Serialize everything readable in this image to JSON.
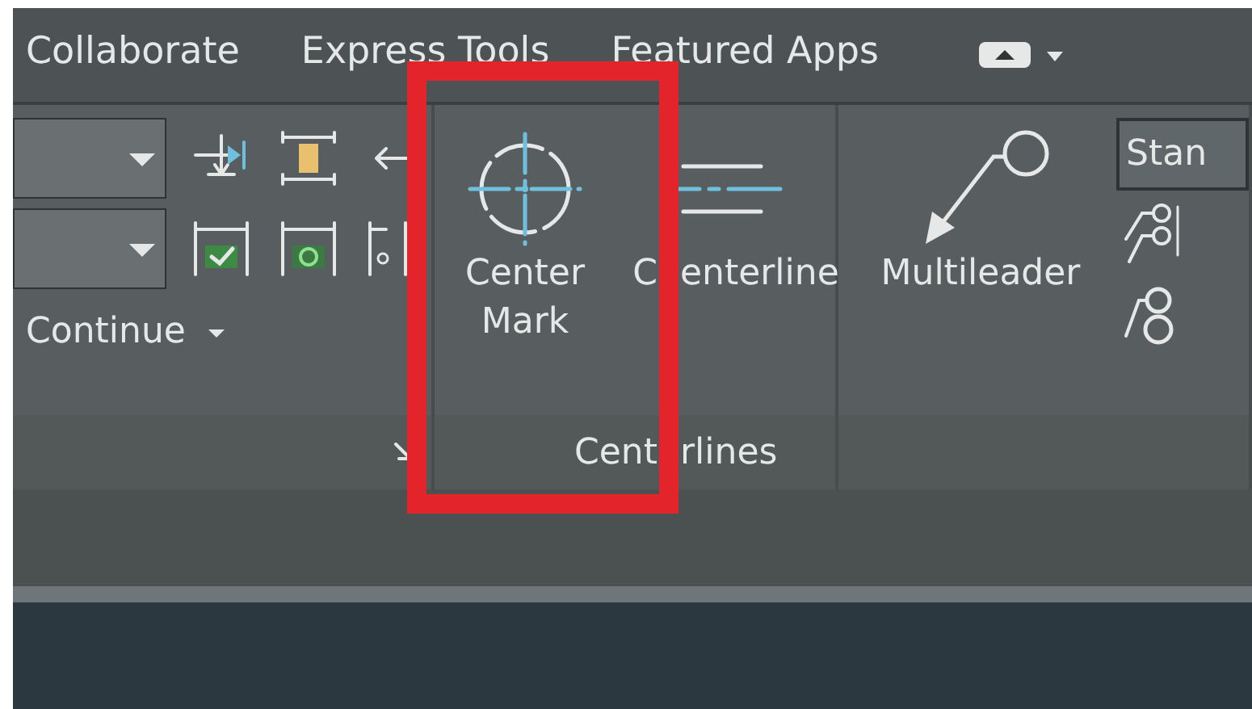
{
  "tabs": [
    {
      "label": "Collaborate"
    },
    {
      "label": "Express Tools"
    },
    {
      "label": "Featured Apps"
    }
  ],
  "panels": [
    {
      "kind": "dimensions",
      "split_button": "Continue"
    },
    {
      "kind": "centerlines",
      "title_parts": [
        "Cent",
        "rlines"
      ],
      "buttons": [
        {
          "kind": "center-mark",
          "label": "Center Mark"
        },
        {
          "kind": "centerline",
          "label_parts": [
            "C",
            "enterline"
          ]
        }
      ]
    },
    {
      "kind": "leaders",
      "buttons": [
        {
          "kind": "multileader",
          "label": "Multileader"
        }
      ],
      "style_field": "Stan"
    }
  ]
}
